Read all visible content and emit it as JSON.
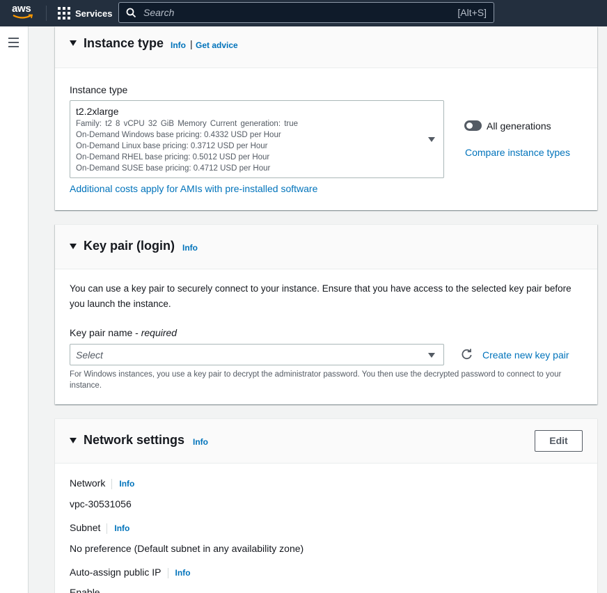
{
  "topnav": {
    "logo_text": "aws",
    "services_label": "Services",
    "search_placeholder": "Search",
    "search_shortcut": "[Alt+S]"
  },
  "instance_type": {
    "title": "Instance type",
    "info": "Info",
    "separator": "|",
    "get_advice": "Get advice",
    "field_label": "Instance type",
    "selected": {
      "name": "t2.2xlarge",
      "family_line": "Family: t2    8 vCPU    32 GiB Memory    Current generation: true",
      "pricing": [
        "On-Demand Windows base pricing: 0.4332 USD per Hour",
        "On-Demand Linux base pricing: 0.3712 USD per Hour",
        "On-Demand RHEL base pricing: 0.5012 USD per Hour",
        "On-Demand SUSE base pricing: 0.4712 USD per Hour"
      ]
    },
    "all_generations_label": "All generations",
    "all_generations_on": false,
    "compare_link": "Compare instance types",
    "additional_costs_link": "Additional costs apply for AMIs with pre-installed software"
  },
  "key_pair": {
    "title": "Key pair (login)",
    "info": "Info",
    "description": "You can use a key pair to securely connect to your instance. Ensure that you have access to the selected key pair before you launch the instance.",
    "field_label": "Key pair name - ",
    "field_required": "required",
    "placeholder": "Select",
    "create_link": "Create new key pair",
    "hint": "For Windows instances, you use a key pair to decrypt the administrator password. You then use the decrypted password to connect to your instance."
  },
  "network": {
    "title": "Network settings",
    "info": "Info",
    "edit_label": "Edit",
    "rows": [
      {
        "label": "Network",
        "info": "Info",
        "value": "vpc-30531056"
      },
      {
        "label": "Subnet",
        "info": "Info",
        "value": "No preference (Default subnet in any availability zone)"
      },
      {
        "label": "Auto-assign public IP",
        "info": "Info",
        "value": "Enable"
      }
    ]
  },
  "colors": {
    "nav_bg": "#232f3e",
    "link": "#0073bb",
    "page_bg": "#f2f3f3"
  }
}
